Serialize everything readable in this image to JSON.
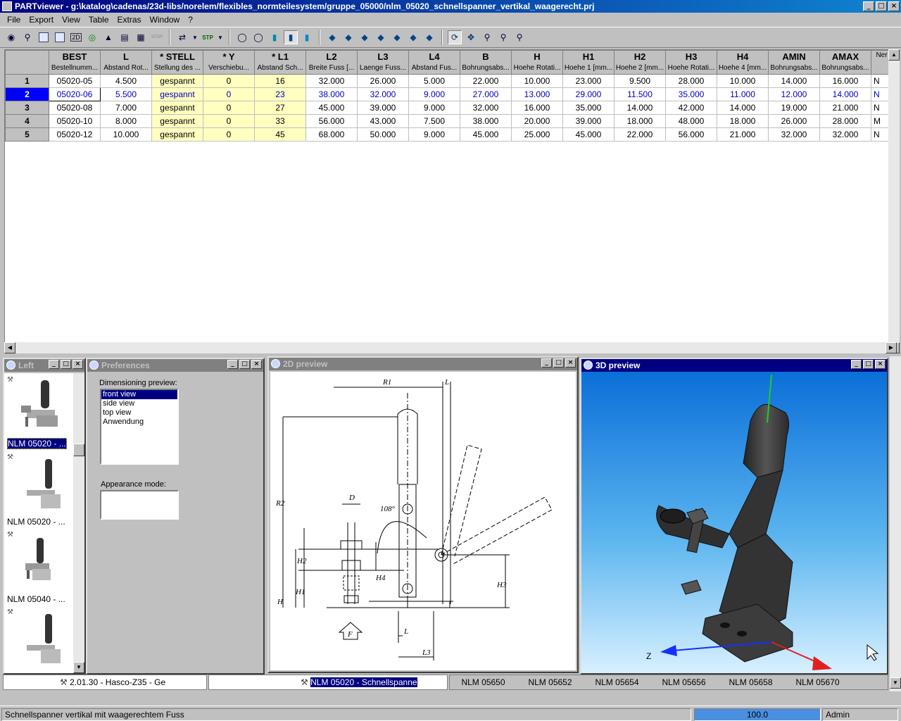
{
  "window": {
    "title": "PARTviewer - g:\\katalog\\cadenas/23d-libs/norelem/flexibles_normteilesystem/gruppe_05000/nlm_05020_schnellspanner_vertikal_waagerecht.prj"
  },
  "menu": [
    "File",
    "Export",
    "View",
    "Table",
    "Extras",
    "Window",
    "?"
  ],
  "toolbar": {
    "btn_2d": "2D",
    "btn_stp": "STP",
    "btn_stop": "STOP"
  },
  "table": {
    "columns": [
      {
        "name": "BEST",
        "desc": "Bestellnumm..."
      },
      {
        "name": "L",
        "desc": "Abstand Rot..."
      },
      {
        "name": "* STELL",
        "desc": "Stellung des ..."
      },
      {
        "name": "* Y",
        "desc": "Verschiebu..."
      },
      {
        "name": "* L1",
        "desc": "Abstand Sch..."
      },
      {
        "name": "L2",
        "desc": "Breite Fuss [..."
      },
      {
        "name": "L3",
        "desc": "Laenge Fuss..."
      },
      {
        "name": "L4",
        "desc": "Abstand Fus..."
      },
      {
        "name": "B",
        "desc": "Bohrungsabs..."
      },
      {
        "name": "H",
        "desc": "Hoehe Rotati..."
      },
      {
        "name": "H1",
        "desc": "Hoehe 1 [mm..."
      },
      {
        "name": "H2",
        "desc": "Hoehe 2 [mm..."
      },
      {
        "name": "H3",
        "desc": "Hoehe Rotati..."
      },
      {
        "name": "H4",
        "desc": "Hoehe 4 [mm..."
      },
      {
        "name": "AMIN",
        "desc": "Bohrungsabs..."
      },
      {
        "name": "AMAX",
        "desc": "Bohrungsabs..."
      },
      {
        "name": "",
        "desc": "Ner"
      }
    ],
    "rows": [
      {
        "n": "1",
        "cells": [
          "05020-05",
          "4.500",
          "gespannt",
          "0",
          "16",
          "32.000",
          "26.000",
          "5.000",
          "22.000",
          "10.000",
          "23.000",
          "9.500",
          "28.000",
          "10.000",
          "14.000",
          "16.000",
          "N"
        ]
      },
      {
        "n": "2",
        "cells": [
          "05020-06",
          "5.500",
          "gespannt",
          "0",
          "23",
          "38.000",
          "32.000",
          "9.000",
          "27.000",
          "13.000",
          "29.000",
          "11.500",
          "35.000",
          "11.000",
          "12.000",
          "14.000",
          "N"
        ]
      },
      {
        "n": "3",
        "cells": [
          "05020-08",
          "7.000",
          "gespannt",
          "0",
          "27",
          "45.000",
          "39.000",
          "9.000",
          "32.000",
          "16.000",
          "35.000",
          "14.000",
          "42.000",
          "14.000",
          "19.000",
          "21.000",
          "N"
        ]
      },
      {
        "n": "4",
        "cells": [
          "05020-10",
          "8.000",
          "gespannt",
          "0",
          "33",
          "56.000",
          "43.000",
          "7.500",
          "38.000",
          "20.000",
          "39.000",
          "18.000",
          "48.000",
          "18.000",
          "26.000",
          "28.000",
          "M"
        ]
      },
      {
        "n": "5",
        "cells": [
          "05020-12",
          "10.000",
          "gespannt",
          "0",
          "45",
          "68.000",
          "50.000",
          "9.000",
          "45.000",
          "25.000",
          "45.000",
          "22.000",
          "56.000",
          "21.000",
          "32.000",
          "32.000",
          "N"
        ]
      }
    ],
    "selected_row": 1
  },
  "left_panel": {
    "title": "Left",
    "items": [
      "NLM 05020 - ...",
      "NLM 05020 - ...",
      "NLM 05040 - ...",
      ""
    ]
  },
  "preferences": {
    "title": "Preferences",
    "dim_label": "Dimensioning preview:",
    "dim_options": [
      "front view",
      "side view",
      "top view",
      "Anwendung"
    ],
    "appearance_label": "Appearance mode:"
  },
  "preview2d": {
    "title": "2D preview",
    "labels": [
      "R1",
      "L",
      "R2",
      "D",
      "108°",
      "H2",
      "H1",
      "H",
      "H4",
      "H3",
      "L",
      "L3",
      "F"
    ]
  },
  "preview3d": {
    "title": "3D preview",
    "axis_z": "Z"
  },
  "bottom_strip": {
    "left_text": "2.01.30 - Hasco-Z35 - Ge",
    "mid_text": "NLM 05020  -  Schnellspanne",
    "right_items": [
      "NLM 05650",
      "NLM 05652",
      "NLM 05654",
      "NLM 05656",
      "NLM 05658",
      "NLM 05670"
    ]
  },
  "status": {
    "text": "Schnellspanner vertikal mit waagerechtem  Fuss",
    "progress_value": "100.0",
    "progress_fraction": 1.0,
    "user": "Admin"
  },
  "colors": {
    "title_active": "#000080",
    "selection": "#0000ff",
    "yellow_cell": "#ffffc0",
    "viewport_bg_top": "#0a6fd8"
  }
}
